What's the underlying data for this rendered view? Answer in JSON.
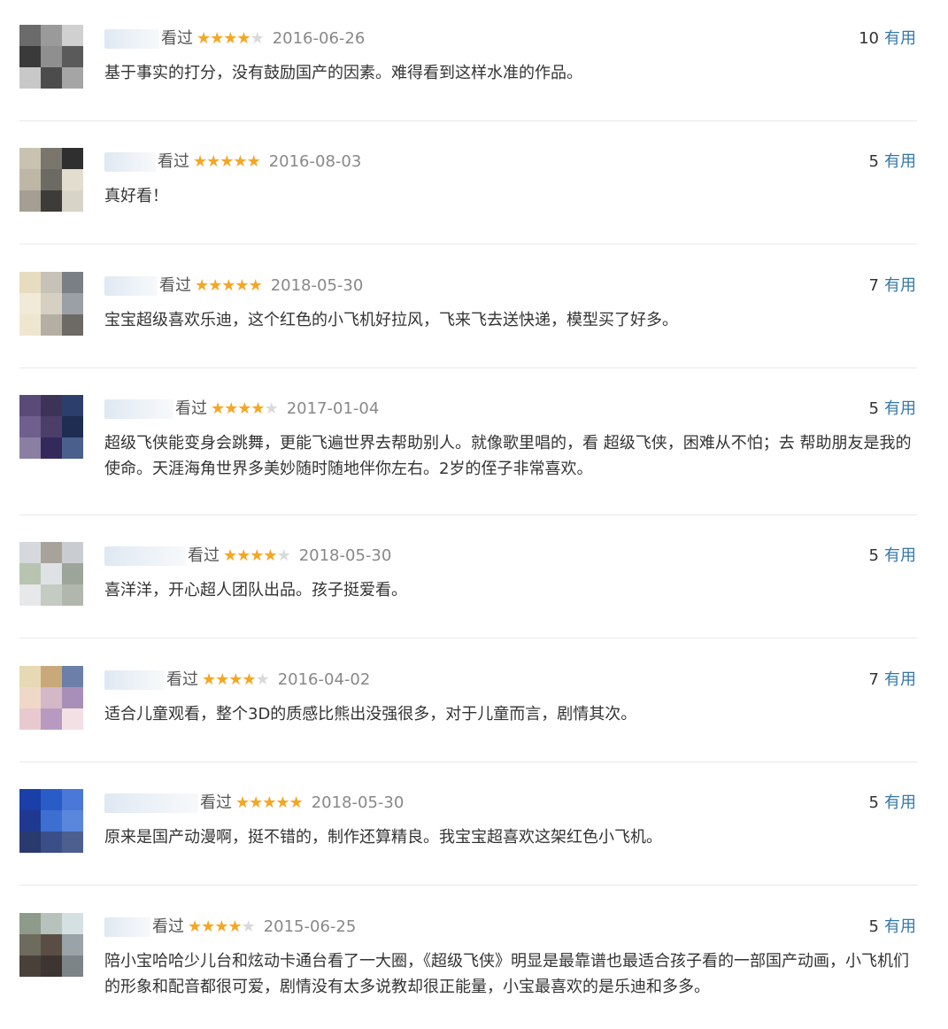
{
  "reviews": [
    {
      "seen": "看过",
      "stars": 4,
      "date": "2016-06-26",
      "votes": "10",
      "useful_label": "有用",
      "content": "基于事实的打分，没有鼓励国产的因素。难得看到这样水准的作品。",
      "avatar_colors": [
        "#6b6b6b",
        "#9a9a9a",
        "#d0d0d0",
        "#3a3a3a",
        "#8f8f8f",
        "#5a5a5a",
        "#c8c8c8",
        "#4c4c4c",
        "#a5a5a5"
      ]
    },
    {
      "seen": "看过",
      "stars": 5,
      "date": "2016-08-03",
      "votes": "5",
      "useful_label": "有用",
      "content": "真好看！",
      "avatar_colors": [
        "#c9c2b0",
        "#7a766c",
        "#2f2f2f",
        "#bfb7a5",
        "#6d6a64",
        "#e3ddd0",
        "#a59f93",
        "#3e3c39",
        "#d9d4c8"
      ]
    },
    {
      "seen": "看过",
      "stars": 5,
      "date": "2018-05-30",
      "votes": "7",
      "useful_label": "有用",
      "content": "宝宝超级喜欢乐迪，这个红色的小飞机好拉风，飞来飞去送快递，模型买了好多。",
      "avatar_colors": [
        "#e8dcc0",
        "#c7c2b8",
        "#7a7f86",
        "#f1ead8",
        "#d6d0c2",
        "#9aa0a6",
        "#efe6cf",
        "#b5afa3",
        "#6d6a66"
      ]
    },
    {
      "seen": "看过",
      "stars": 4,
      "date": "2017-01-04",
      "votes": "5",
      "useful_label": "有用",
      "content": "超级飞侠能变身会跳舞，更能飞遍世界去帮助别人。就像歌里唱的，看 超级飞侠，困难从不怕；去 帮助朋友是我的使命。天涯海角世界多美妙随时随地伴你左右。2岁的侄子非常喜欢。",
      "avatar_colors": [
        "#5a4a78",
        "#3d3357",
        "#2c3e6b",
        "#6e5f8f",
        "#4b3f6a",
        "#1f2d52",
        "#8a7fa3",
        "#33295a",
        "#4a5f8c"
      ]
    },
    {
      "seen": "看过",
      "stars": 4,
      "date": "2018-05-30",
      "votes": "5",
      "useful_label": "有用",
      "content": "喜洋洋，开心超人团队出品。孩子挺爱看。",
      "avatar_colors": [
        "#d5d8dc",
        "#a7a39b",
        "#c9cdd1",
        "#b8c4b0",
        "#dfe2e5",
        "#9da59a",
        "#e6e8ea",
        "#c4cbc2",
        "#b2b7ae"
      ]
    },
    {
      "seen": "看过",
      "stars": 4,
      "date": "2016-04-02",
      "votes": "7",
      "useful_label": "有用",
      "content": "适合儿童观看，整个3D的质感比熊出没强很多，对于儿童而言，剧情其次。",
      "avatar_colors": [
        "#e8d9b5",
        "#c9a97a",
        "#6b7fa8",
        "#f0d8c8",
        "#d4b8c8",
        "#a88fb8",
        "#e9c9d0",
        "#b89ac0",
        "#f3e0e5"
      ]
    },
    {
      "seen": "看过",
      "stars": 5,
      "date": "2018-05-30",
      "votes": "5",
      "useful_label": "有用",
      "content": "原来是国产动漫啊，挺不错的，制作还算精良。我宝宝超喜欢这架红色小飞机。",
      "avatar_colors": [
        "#1a3fa8",
        "#2a5cc8",
        "#4a78d8",
        "#1f3990",
        "#3d6fd0",
        "#5a86dc",
        "#2a3a6e",
        "#3a4f88",
        "#4c5f8f"
      ]
    },
    {
      "seen": "看过",
      "stars": 4,
      "date": "2015-06-25",
      "votes": "5",
      "useful_label": "有用",
      "content": "陪小宝哈哈少儿台和炫动卡通台看了一大圈，《超级飞侠》明显是最靠谱也最适合孩子看的一部国产动画，小飞机们的形象和配音都很可爱，剧情没有太多说教却很正能量，小宝最喜欢的是乐迪和多多。",
      "avatar_colors": [
        "#8e9a8a",
        "#b8c2bd",
        "#d5e0e3",
        "#6d6a5e",
        "#5a4e44",
        "#9aa3a8",
        "#4a403a",
        "#3d3530",
        "#7d8488"
      ]
    }
  ]
}
